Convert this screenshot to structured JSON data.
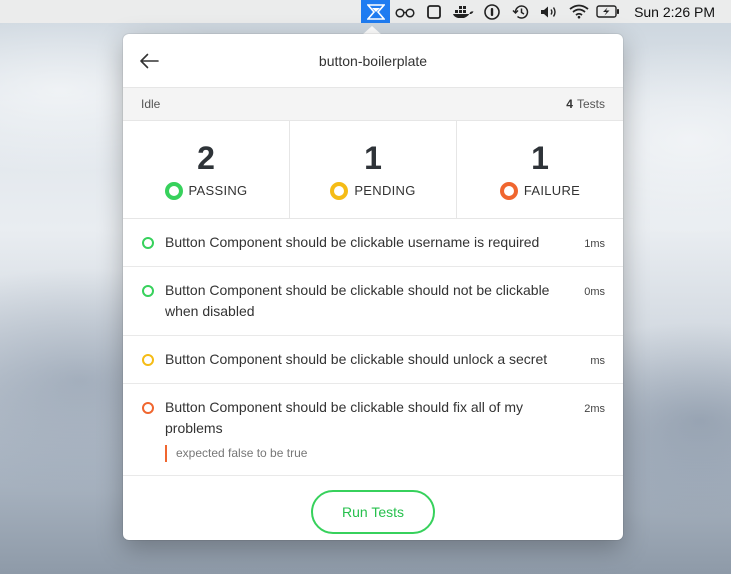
{
  "menubar": {
    "icons": [
      "app-icon",
      "glasses-icon",
      "square-icon",
      "docker-icon",
      "info-icon",
      "time-machine-icon",
      "volume-icon",
      "wifi-icon",
      "battery-icon"
    ],
    "clock": "Sun 2:26 PM"
  },
  "panel": {
    "title": "button-boilerplate",
    "status": "Idle",
    "test_count": "4",
    "test_count_label": "Tests"
  },
  "stats": [
    {
      "count": "2",
      "label": "PASSING",
      "color": "#37d15c"
    },
    {
      "count": "1",
      "label": "PENDING",
      "color": "#f5bc16"
    },
    {
      "count": "1",
      "label": "FAILURE",
      "color": "#f0662f"
    }
  ],
  "tests": [
    {
      "status": "passing",
      "name": "Button Component should be clickable username is required",
      "time": "1ms"
    },
    {
      "status": "passing",
      "name": "Button Component should be clickable should not be clickable when disabled",
      "time": "0ms"
    },
    {
      "status": "pending",
      "name": "Button Component should be clickable should unlock a secret",
      "time": "ms"
    },
    {
      "status": "failure",
      "name": "Button Component should be clickable should fix all of my problems",
      "time": "2ms",
      "error": "expected false to be true"
    }
  ],
  "footer": {
    "run_label": "Run Tests"
  }
}
